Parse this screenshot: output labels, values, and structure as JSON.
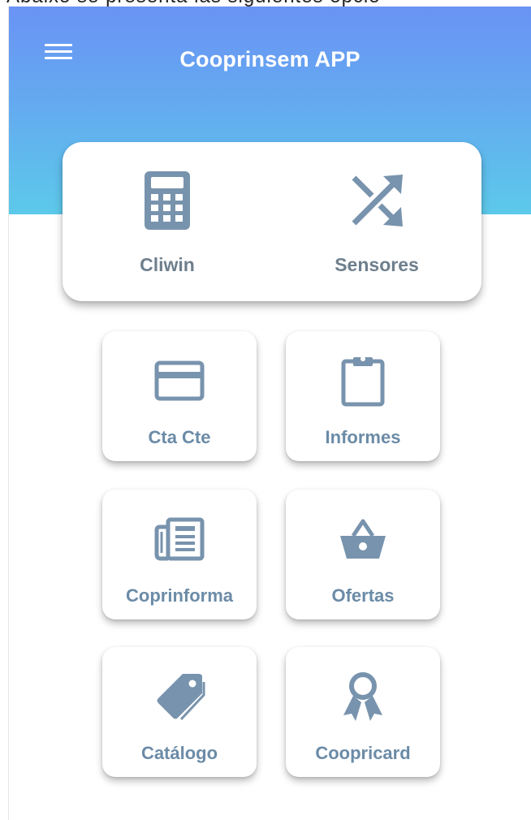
{
  "top_cropped_text": "Abaixo se presenta las siguientes opcio",
  "app": {
    "title": "Cooprinsem APP"
  },
  "colors": {
    "header_gradient_top": "#6a93f5",
    "header_gradient_bottom": "#5cc9ea",
    "icon_color": "#7893ad",
    "label_color": "#6b8ba7"
  },
  "top_menu": {
    "items": [
      {
        "label": "Cliwin",
        "icon": "calculator-icon"
      },
      {
        "label": "Sensores",
        "icon": "shuffle-icon"
      }
    ]
  },
  "grid": {
    "items": [
      {
        "label": "Cta Cte",
        "icon": "credit-card-icon"
      },
      {
        "label": "Informes",
        "icon": "clipboard-icon"
      },
      {
        "label": "Coprinforma",
        "icon": "newspaper-icon"
      },
      {
        "label": "Ofertas",
        "icon": "shopping-basket-icon"
      },
      {
        "label": "Catálogo",
        "icon": "tags-icon"
      },
      {
        "label": "Coopricard",
        "icon": "award-icon"
      }
    ]
  }
}
